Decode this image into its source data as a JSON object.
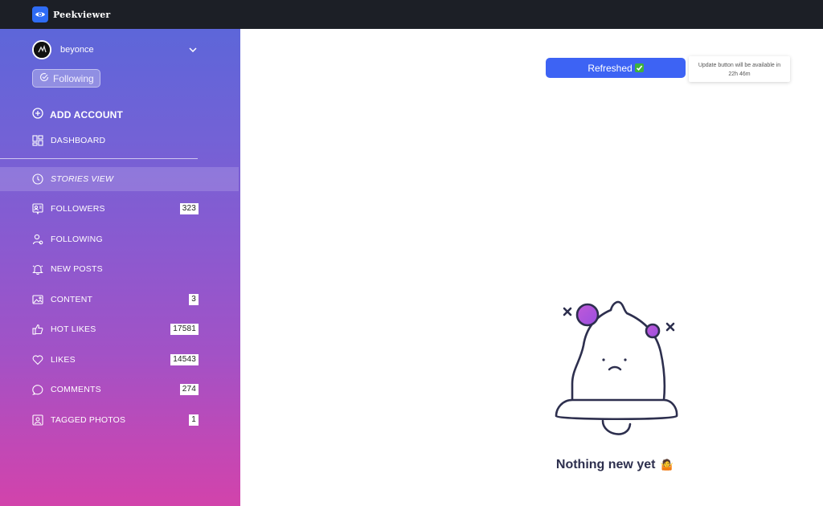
{
  "app": {
    "name": "Peekviewer"
  },
  "account": {
    "username": "beyonce",
    "follow_status": "Following"
  },
  "sidebar": {
    "add_account": "ADD ACCOUNT",
    "dashboard": "DASHBOARD",
    "items": [
      {
        "label": "STORIES VIEW",
        "icon": "clock-icon",
        "active": true
      },
      {
        "label": "FOLLOWERS",
        "icon": "followers-icon",
        "count": "323"
      },
      {
        "label": "FOLLOWING",
        "icon": "user-icon"
      },
      {
        "label": "NEW POSTS",
        "icon": "bell-icon"
      },
      {
        "label": "CONTENT",
        "icon": "image-icon",
        "count": "3"
      },
      {
        "label": "HOT LIKES",
        "icon": "thumbs-up-icon",
        "count": "17581"
      },
      {
        "label": "LIKES",
        "icon": "heart-icon",
        "count": "14543"
      },
      {
        "label": "COMMENTS",
        "icon": "comment-icon",
        "count": "274"
      },
      {
        "label": "TAGGED PHOTOS",
        "icon": "tagged-photo-icon",
        "count": "1"
      }
    ]
  },
  "main": {
    "refresh_button": "Refreshed",
    "refresh_emoji": "✅",
    "tooltip_line1": "Update button will be available in",
    "tooltip_line2": "22h 46m",
    "empty_message": "Nothing new yet",
    "empty_emoji": "🤷"
  },
  "colors": {
    "topbar": "#1c1f26",
    "accent_button": "#3d63f4",
    "sidebar_gradient_top": "#5d66d9",
    "sidebar_gradient_bottom": "#d243ab",
    "empty_text": "#2d2f4e"
  }
}
